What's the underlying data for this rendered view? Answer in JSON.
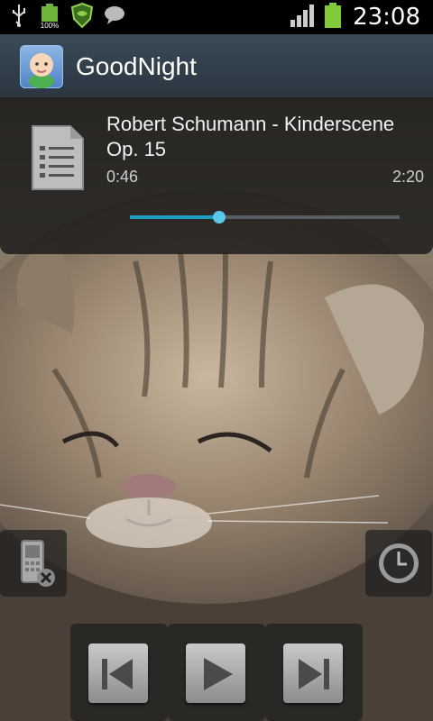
{
  "status_bar": {
    "left_icons": [
      "usb-icon",
      "battery-100-icon",
      "lookout-shield-icon",
      "chat-bubble-icon"
    ],
    "battery_indicator_label": "100%",
    "signal_icon": "signal-bars-icon",
    "battery_icon": "battery-icon",
    "time": "23:08"
  },
  "app_bar": {
    "icon": "baby-face-icon",
    "title": "GoodNight"
  },
  "player": {
    "icon": "document-list-icon",
    "track_title": "Robert Schumann - Kinderscene Op. 15",
    "elapsed": "0:46",
    "total": "2:20",
    "progress_fraction": 0.33,
    "accent": "#1f9ec5"
  },
  "side_buttons": {
    "left_icon": "phone-off-icon",
    "right_icon": "clock-timer-icon"
  },
  "controls": [
    {
      "icon": "skip-previous-icon"
    },
    {
      "icon": "play-icon"
    },
    {
      "icon": "skip-next-icon"
    }
  ]
}
